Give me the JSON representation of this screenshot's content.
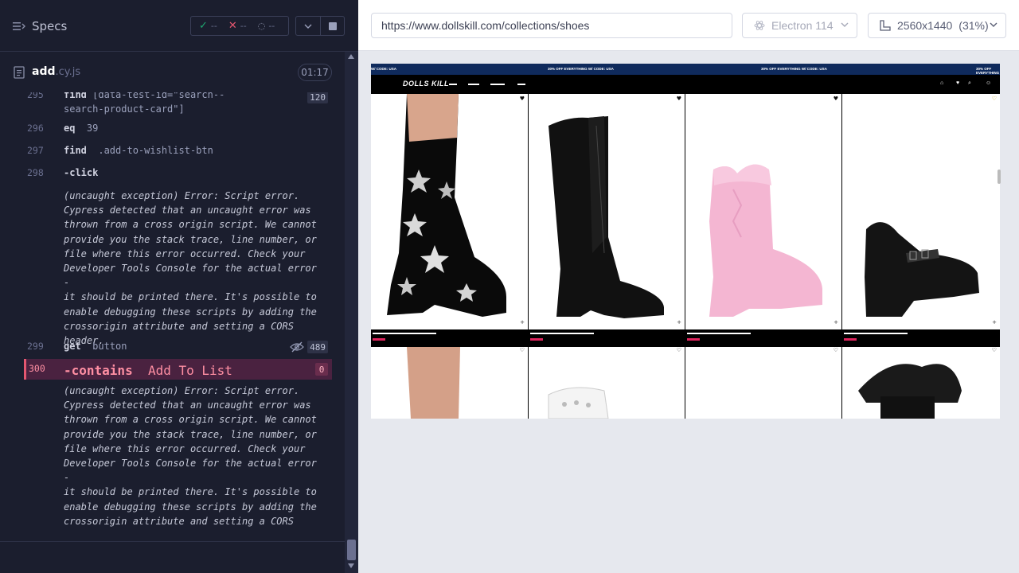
{
  "reporter": {
    "specs_label": "Specs",
    "stats": {
      "passed": "--",
      "failed": "--",
      "pending": "--"
    },
    "spec_file": {
      "name": "add",
      "ext": ".cy.js",
      "duration": "01:17"
    },
    "commands": [
      {
        "line": "295",
        "name": "find",
        "arg": "[data-test-id=\"search--search-product-card\"]",
        "badge": "120"
      },
      {
        "line": "296",
        "name": "eq",
        "arg": "39"
      },
      {
        "line": "297",
        "name": "find",
        "arg": ".add-to-wishlist-btn"
      },
      {
        "line": "298",
        "name": "-click",
        "arg": ""
      },
      {
        "line": "299",
        "name": "get",
        "arg": "button",
        "badge": "489"
      },
      {
        "line": "300",
        "name": "-contains",
        "arg": "Add To List",
        "badge": "0"
      }
    ],
    "error_lines": [
      "(uncaught exception)  Error: Script error.",
      "Cypress detected that an uncaught error was",
      "thrown from a cross origin script. We cannot",
      "provide you the stack trace, line number, or",
      "file where this error occurred. Check your",
      "Developer Tools Console for the actual error -",
      "it should be printed there. It's possible to",
      "enable debugging these scripts by adding the",
      "crossorigin attribute and setting a CORS",
      "header."
    ]
  },
  "aut": {
    "url": "https://www.dollskill.com/collections/shoes",
    "browser": "Electron 114",
    "viewport": "2560x1440",
    "scale": "(31%)"
  },
  "site": {
    "promo": "30% OFF EVERYTHING W/ CODE: USA",
    "promo_start": "W/ CODE: USA",
    "logo": "DOLLS KILL"
  },
  "colors": {
    "accent_error": "#e45770",
    "promo_bg": "#0f2a5c"
  }
}
